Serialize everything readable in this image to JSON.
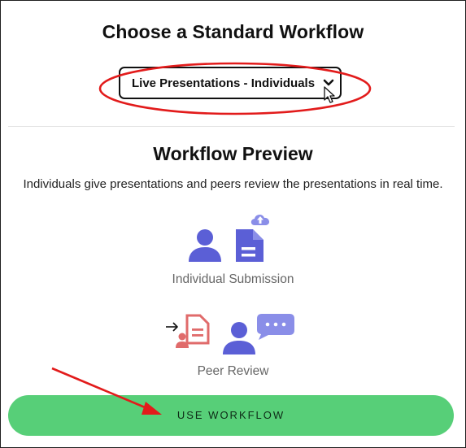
{
  "heading": "Choose a Standard Workflow",
  "workflow_select": {
    "selected_value": "Live Presentations - Individuals"
  },
  "preview": {
    "title": "Workflow Preview",
    "description": "Individuals give presentations and peers review the presentations in real time.",
    "steps": [
      {
        "label": "Individual Submission",
        "icon": "individual-submission-icon"
      },
      {
        "label": "Peer Review",
        "icon": "peer-review-icon"
      }
    ]
  },
  "actions": {
    "use_workflow_label": "USE WORKFLOW"
  },
  "colors": {
    "icon_primary": "#5b5fd6",
    "icon_light": "#8a8ee8",
    "icon_red": "#e06b6b",
    "button_green": "#57cf78",
    "annotation_red": "#e21b1b"
  }
}
